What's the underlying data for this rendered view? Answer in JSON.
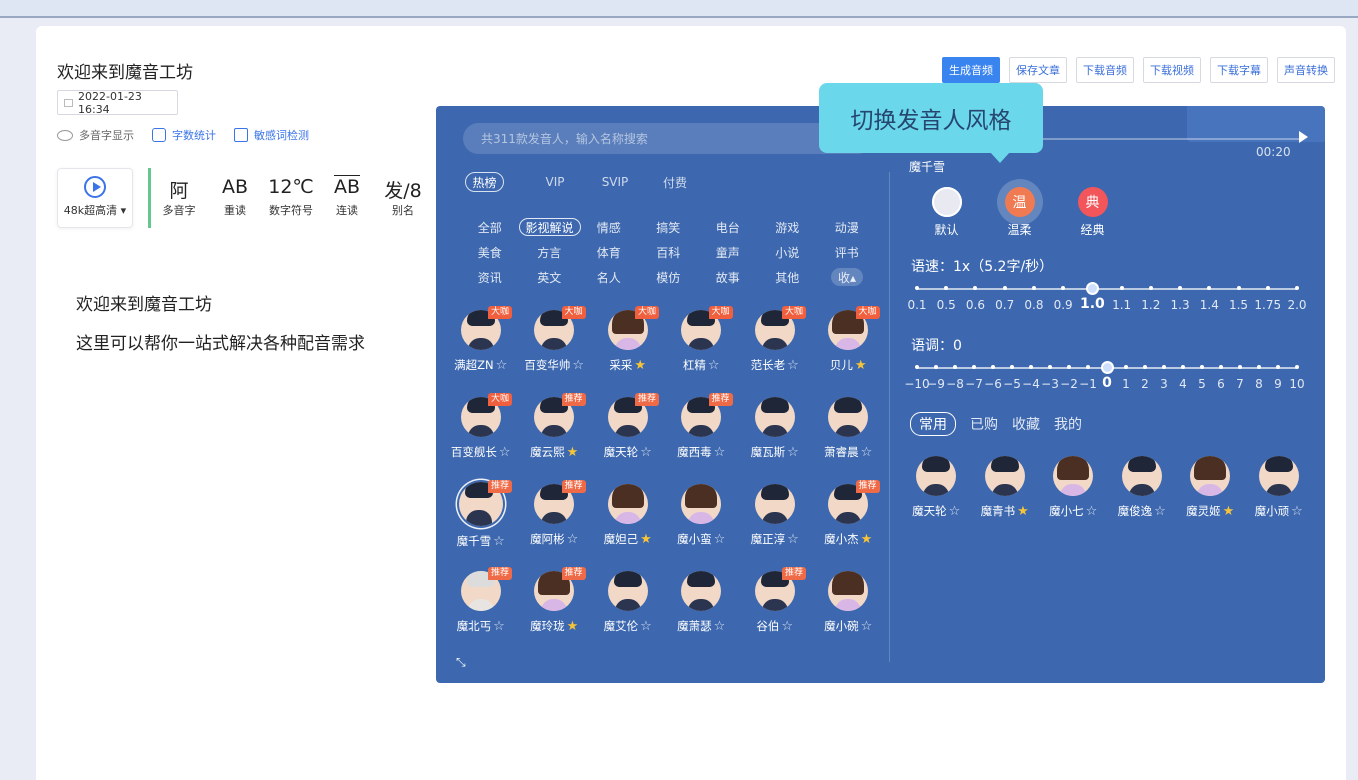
{
  "doc": {
    "title": "欢迎来到魔音工坊",
    "date": "2022-01-23 16:34",
    "tools": [
      "多音字显示",
      "字数统计",
      "敏感词检测"
    ],
    "quality": "48k超高清",
    "formats": [
      {
        "glyph": "阿",
        "label": "多音字"
      },
      {
        "glyph": "AB",
        "label": "重读"
      },
      {
        "glyph": "12℃",
        "label": "数字符号"
      },
      {
        "glyph": "AB",
        "label": "连读"
      },
      {
        "glyph": "发/8",
        "label": "别名"
      }
    ],
    "lines": [
      "欢迎来到魔音工坊",
      "这里可以帮你一站式解决各种配音需求"
    ]
  },
  "actions": [
    "生成音频",
    "保存文章",
    "下载音频",
    "下载视频",
    "下载字幕",
    "声音转换"
  ],
  "panel": {
    "search_placeholder": "共311款发音人，输入名称搜索",
    "tiers": [
      "热榜",
      "VIP",
      "SVIP",
      "付费"
    ],
    "active_tier": 0,
    "categories": [
      "全部",
      "影视解说",
      "情感",
      "搞笑",
      "电台",
      "游戏",
      "动漫",
      "美食",
      "方言",
      "体育",
      "百科",
      "童声",
      "小说",
      "评书",
      "资讯",
      "英文",
      "名人",
      "模仿",
      "故事",
      "其他",
      "收▴"
    ],
    "active_category": 1,
    "speakers": [
      {
        "name": "满超ZN",
        "badge": "大咖",
        "fav": false,
        "type": "m"
      },
      {
        "name": "百变华帅",
        "badge": "大咖",
        "fav": false,
        "type": "m"
      },
      {
        "name": "采采",
        "badge": "大咖",
        "fav": true,
        "type": "f"
      },
      {
        "name": "杠精",
        "badge": "大咖",
        "fav": false,
        "type": "m"
      },
      {
        "name": "范长老",
        "badge": "大咖",
        "fav": false,
        "type": "m"
      },
      {
        "name": "贝儿",
        "badge": "大咖",
        "fav": true,
        "type": "f"
      },
      {
        "name": "百变舰长",
        "badge": "大咖",
        "fav": false,
        "type": "m"
      },
      {
        "name": "魔云熙",
        "badge": "推荐",
        "fav": true,
        "type": "m"
      },
      {
        "name": "魔天轮",
        "badge": "推荐",
        "fav": false,
        "type": "m"
      },
      {
        "name": "魔西毒",
        "badge": "推荐",
        "fav": false,
        "type": "m"
      },
      {
        "name": "魔瓦斯",
        "badge": "",
        "fav": false,
        "type": "m"
      },
      {
        "name": "萧睿晨",
        "badge": "",
        "fav": false,
        "type": "m"
      },
      {
        "name": "魔千雪",
        "badge": "推荐",
        "fav": false,
        "type": "m",
        "current": true
      },
      {
        "name": "魔阿彬",
        "badge": "推荐",
        "fav": false,
        "type": "m"
      },
      {
        "name": "魔妲己",
        "badge": "",
        "fav": true,
        "type": "f"
      },
      {
        "name": "魔小蛮",
        "badge": "",
        "fav": false,
        "type": "f"
      },
      {
        "name": "魔正淳",
        "badge": "",
        "fav": false,
        "type": "m"
      },
      {
        "name": "魔小杰",
        "badge": "推荐",
        "fav": true,
        "type": "m"
      },
      {
        "name": "魔北丐",
        "badge": "推荐",
        "fav": false,
        "type": "gray"
      },
      {
        "name": "魔玲珑",
        "badge": "推荐",
        "fav": true,
        "type": "f"
      },
      {
        "name": "魔艾伦",
        "badge": "",
        "fav": false,
        "type": "m"
      },
      {
        "name": "魔萧瑟",
        "badge": "",
        "fav": false,
        "type": "m"
      },
      {
        "name": "谷伯",
        "badge": "推荐",
        "fav": false,
        "type": "m"
      },
      {
        "name": "魔小碗",
        "badge": "",
        "fav": false,
        "type": "f"
      }
    ],
    "current_speaker": "魔千雪",
    "timer": "00:20",
    "styles": [
      {
        "label": "默认",
        "glyph": "",
        "cls": "def"
      },
      {
        "label": "温柔",
        "glyph": "温",
        "cls": "soft"
      },
      {
        "label": "经典",
        "glyph": "典",
        "cls": "classic"
      }
    ],
    "speed_label": "语速：1x（5.2字/秒）",
    "speed_ticks": [
      "0.1",
      "0.5",
      "0.6",
      "0.7",
      "0.8",
      "0.9",
      "1.0",
      "1.1",
      "1.2",
      "1.3",
      "1.4",
      "1.5",
      "1.75",
      "2.0"
    ],
    "speed_value": "1.0",
    "pitch_label": "语调：0",
    "pitch_ticks": [
      "−10",
      "−9",
      "−8",
      "−7",
      "−6",
      "−5",
      "−4",
      "−3",
      "−2",
      "−1",
      "0",
      "1",
      "2",
      "3",
      "4",
      "5",
      "6",
      "7",
      "8",
      "9",
      "10"
    ],
    "pitch_value": "0",
    "fav_tabs": [
      "常用",
      "已购",
      "收藏",
      "我的"
    ],
    "active_fav_tab": 0,
    "favorites": [
      {
        "name": "魔天轮",
        "fav": false,
        "type": "m"
      },
      {
        "name": "魔青书",
        "fav": true,
        "type": "m"
      },
      {
        "name": "魔小七",
        "fav": false,
        "type": "f"
      },
      {
        "name": "魔俊逸",
        "fav": false,
        "type": "m"
      },
      {
        "name": "魔灵姬",
        "fav": true,
        "type": "f"
      },
      {
        "name": "魔小顽",
        "fav": false,
        "type": "m"
      }
    ]
  },
  "tooltip": "切换发音人风格"
}
